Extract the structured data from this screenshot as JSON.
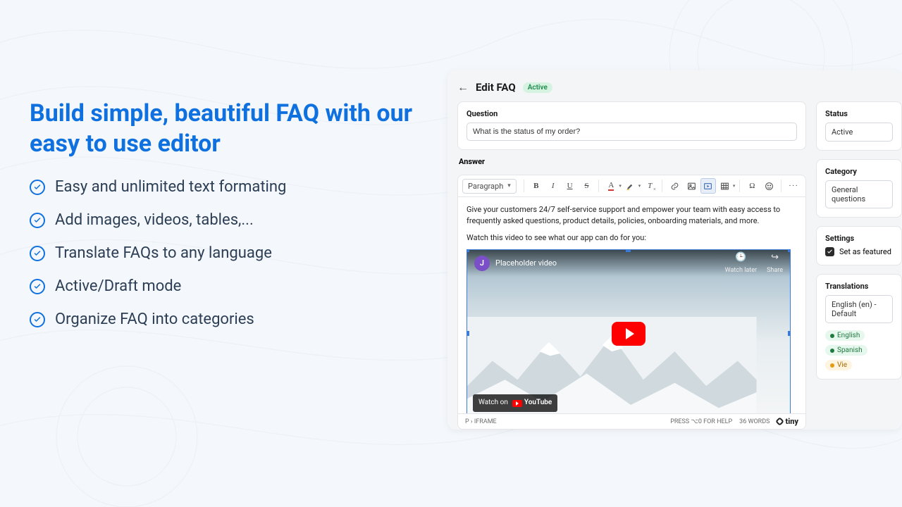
{
  "marketing": {
    "headline": "Build simple, beautiful FAQ with our easy to use editor",
    "bullets": [
      "Easy and unlimited text formating",
      "Add images, videos, tables,...",
      "Translate FAQs to any language",
      "Active/Draft mode",
      "Organize FAQ into categories"
    ]
  },
  "app": {
    "header": {
      "title": "Edit FAQ",
      "badge": "Active"
    },
    "question": {
      "label": "Question",
      "value": "What is the status of my order?"
    },
    "answer": {
      "label": "Answer",
      "paragraph_style": "Paragraph",
      "body_p1": "Give your customers 24/7 self-service support and empower your team with easy access to frequently asked questions, product details, policies, onboarding materials, and more.",
      "body_p2": "Watch this video to see what our app can do for you:",
      "video": {
        "avatar_initial": "J",
        "title": "Placeholder video",
        "watch_later": "Watch later",
        "share": "Share",
        "watch_on": "Watch on",
        "platform": "YouTube"
      },
      "footer": {
        "path_p": "P",
        "path_iframe": "IFRAME",
        "help_hint": "PRESS ⌥0 FOR HELP",
        "word_count": "36 WORDS",
        "brand": "tiny"
      }
    },
    "sidebar": {
      "status": {
        "label": "Status",
        "value": "Active"
      },
      "category": {
        "label": "Category",
        "value": "General questions"
      },
      "settings": {
        "label": "Settings",
        "featured_label": "Set as featured",
        "featured_checked": true
      },
      "translations": {
        "label": "Translations",
        "default": "English (en) - Default",
        "tags": [
          {
            "name": "English",
            "tone": "green"
          },
          {
            "name": "Spanish",
            "tone": "green"
          },
          {
            "name": "Vie",
            "tone": "amber"
          }
        ]
      }
    }
  },
  "colors": {
    "accent": "#0f71df",
    "badge_green_bg": "#d6f3e2",
    "badge_green_fg": "#1f8a4c"
  }
}
